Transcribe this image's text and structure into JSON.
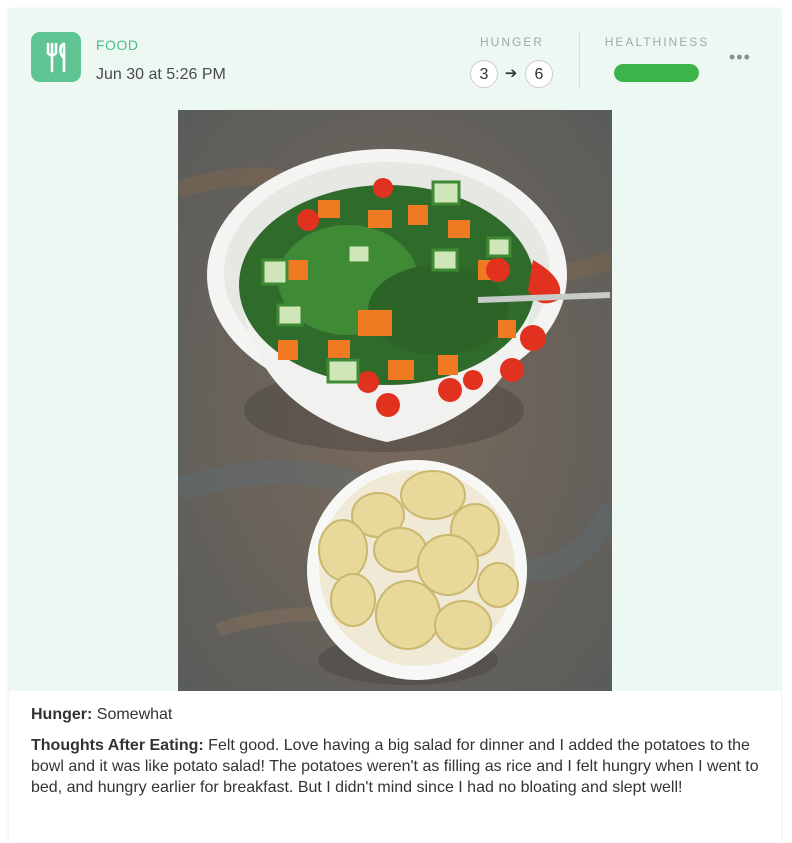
{
  "entry": {
    "category": "FOOD",
    "timestamp": "Jun 30 at 5:26 PM",
    "icon": "fork-knife-icon"
  },
  "hunger": {
    "label": "HUNGER",
    "before": "3",
    "after": "6"
  },
  "healthiness": {
    "label": "HEALTHINESS",
    "level": 1.0,
    "color": "#3bb54a"
  },
  "menu": {
    "icon": "more-horizontal-icon"
  },
  "photo": {
    "subject": "salad-and-potatoes"
  },
  "notes": {
    "hunger_label": "Hunger:",
    "hunger_value": "Somewhat",
    "thoughts_label": "Thoughts After Eating:",
    "thoughts_value": "Felt good. Love having a big salad for dinner and I added the potatoes to the bowl and it was like potato salad! The potatoes weren't as filling as rice and I felt hungry when I went to bed, and hungry earlier for breakfast. But I didn't mind since I had no bloating and slept well!"
  }
}
